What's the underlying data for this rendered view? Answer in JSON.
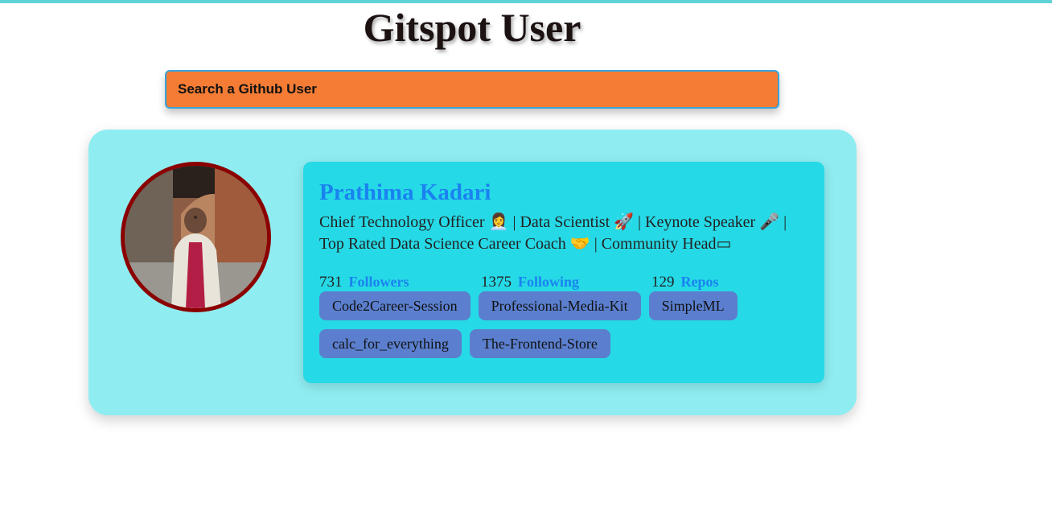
{
  "app": {
    "title": "Gitspot User",
    "accent_color": "#5ed3d6"
  },
  "search": {
    "placeholder": "Search a Github User",
    "value": "",
    "background_color": "#f47c35"
  },
  "profile": {
    "avatar_icon": "user-photo",
    "name": "Prathima Kadari",
    "bio": "Chief Technology Officer 👩‍💼 | Data Scientist 🚀 | Keynote Speaker 🎤 | Top Rated Data Science Career Coach 🤝 | Community Head▭",
    "stats": {
      "followers": {
        "count": "731",
        "label": "Followers"
      },
      "following": {
        "count": "1375",
        "label": "Following"
      },
      "repos": {
        "count": "129",
        "label": "Repos"
      }
    },
    "repositories": [
      "Code2Career-Session",
      "Professional-Media-Kit",
      "SimpleML",
      "calc_for_everything",
      "The-Frontend-Store"
    ]
  },
  "colors": {
    "card_background": "#8fedf1",
    "info_background": "#26d9e6",
    "name_color": "#1a82f0",
    "chip_background": "#5b7fce",
    "avatar_border": "#8b0000"
  }
}
